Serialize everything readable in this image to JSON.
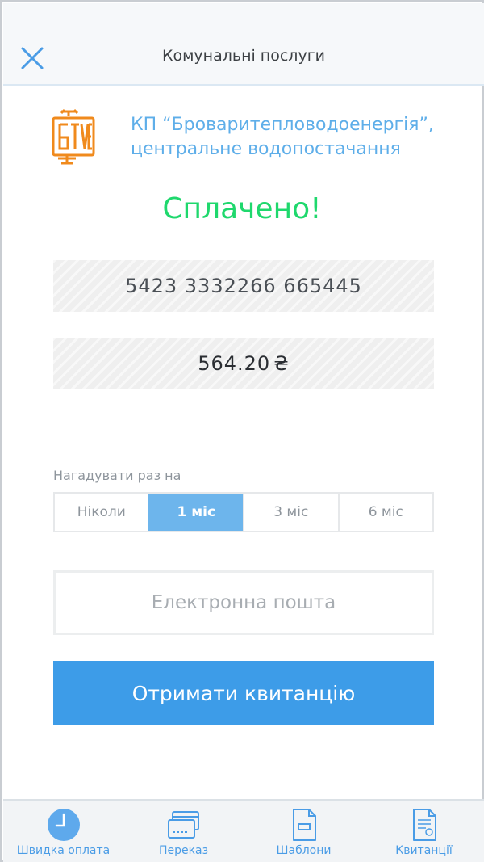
{
  "header": {
    "title": "Комунальні послуги"
  },
  "provider": {
    "name": "КП “Броваритепловодоенергія”, центральне водопостачання",
    "logo_text": "БТВЕ"
  },
  "status": "Сплачено!",
  "payment": {
    "account": "5423 3332266 665445",
    "amount": "564.20",
    "currency": "₴"
  },
  "reminder": {
    "label": "Нагадувати раз на",
    "options": [
      "Ніколи",
      "1 міс",
      "3 міс",
      "6 міс"
    ],
    "selected": "1 міс"
  },
  "email": {
    "placeholder": "Електронна пошта",
    "value": ""
  },
  "receipt_button": "Отримати квитанцію",
  "tabbar": {
    "items": [
      {
        "label": "Швидка оплата",
        "icon": "clock-icon",
        "active": true
      },
      {
        "label": "Переказ",
        "icon": "cards-icon",
        "active": false
      },
      {
        "label": "Шаблони",
        "icon": "template-document-icon",
        "active": false
      },
      {
        "label": "Квитанції",
        "icon": "receipt-document-icon",
        "active": false
      }
    ]
  },
  "colors": {
    "accent": "#3d9ce8",
    "success": "#1fd86d",
    "provider_text": "#5eaee9",
    "logo": "#f08a1c"
  }
}
